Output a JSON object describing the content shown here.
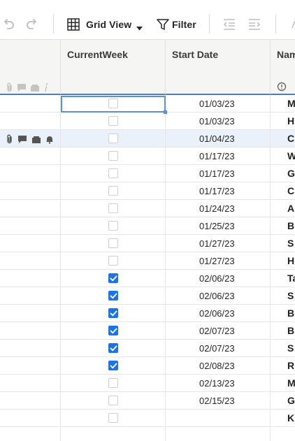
{
  "toolbar": {
    "undo_icon": "undo-icon",
    "redo_icon": "redo-icon",
    "grid_view_label": "Grid View",
    "filter_label": "Filter"
  },
  "columns": {
    "current_week": "CurrentWeek",
    "start_date": "Start Date",
    "name": "Nam"
  },
  "colors": {
    "accent": "#1a73e8",
    "header_bg": "#f5f5f3",
    "selected_row_bg": "#eaf1fb"
  },
  "rows": [
    {
      "checked": false,
      "date": "01/03/23",
      "name": "M"
    },
    {
      "checked": false,
      "date": "01/03/23",
      "name": "H"
    },
    {
      "checked": false,
      "date": "01/04/23",
      "name": "C"
    },
    {
      "checked": false,
      "date": "01/17/23",
      "name": "W"
    },
    {
      "checked": false,
      "date": "01/17/23",
      "name": "G"
    },
    {
      "checked": false,
      "date": "01/17/23",
      "name": "C"
    },
    {
      "checked": false,
      "date": "01/24/23",
      "name": "A"
    },
    {
      "checked": false,
      "date": "01/25/23",
      "name": "B"
    },
    {
      "checked": false,
      "date": "01/27/23",
      "name": "S"
    },
    {
      "checked": false,
      "date": "01/27/23",
      "name": "H"
    },
    {
      "checked": true,
      "date": "02/06/23",
      "name": "Ta"
    },
    {
      "checked": true,
      "date": "02/06/23",
      "name": "S"
    },
    {
      "checked": true,
      "date": "02/06/23",
      "name": "B"
    },
    {
      "checked": true,
      "date": "02/07/23",
      "name": "B"
    },
    {
      "checked": true,
      "date": "02/07/23",
      "name": "S"
    },
    {
      "checked": true,
      "date": "02/08/23",
      "name": "R"
    },
    {
      "checked": false,
      "date": "02/13/23",
      "name": "M"
    },
    {
      "checked": false,
      "date": "02/15/23",
      "name": "G"
    },
    {
      "checked": false,
      "date": "",
      "name": "K"
    }
  ]
}
